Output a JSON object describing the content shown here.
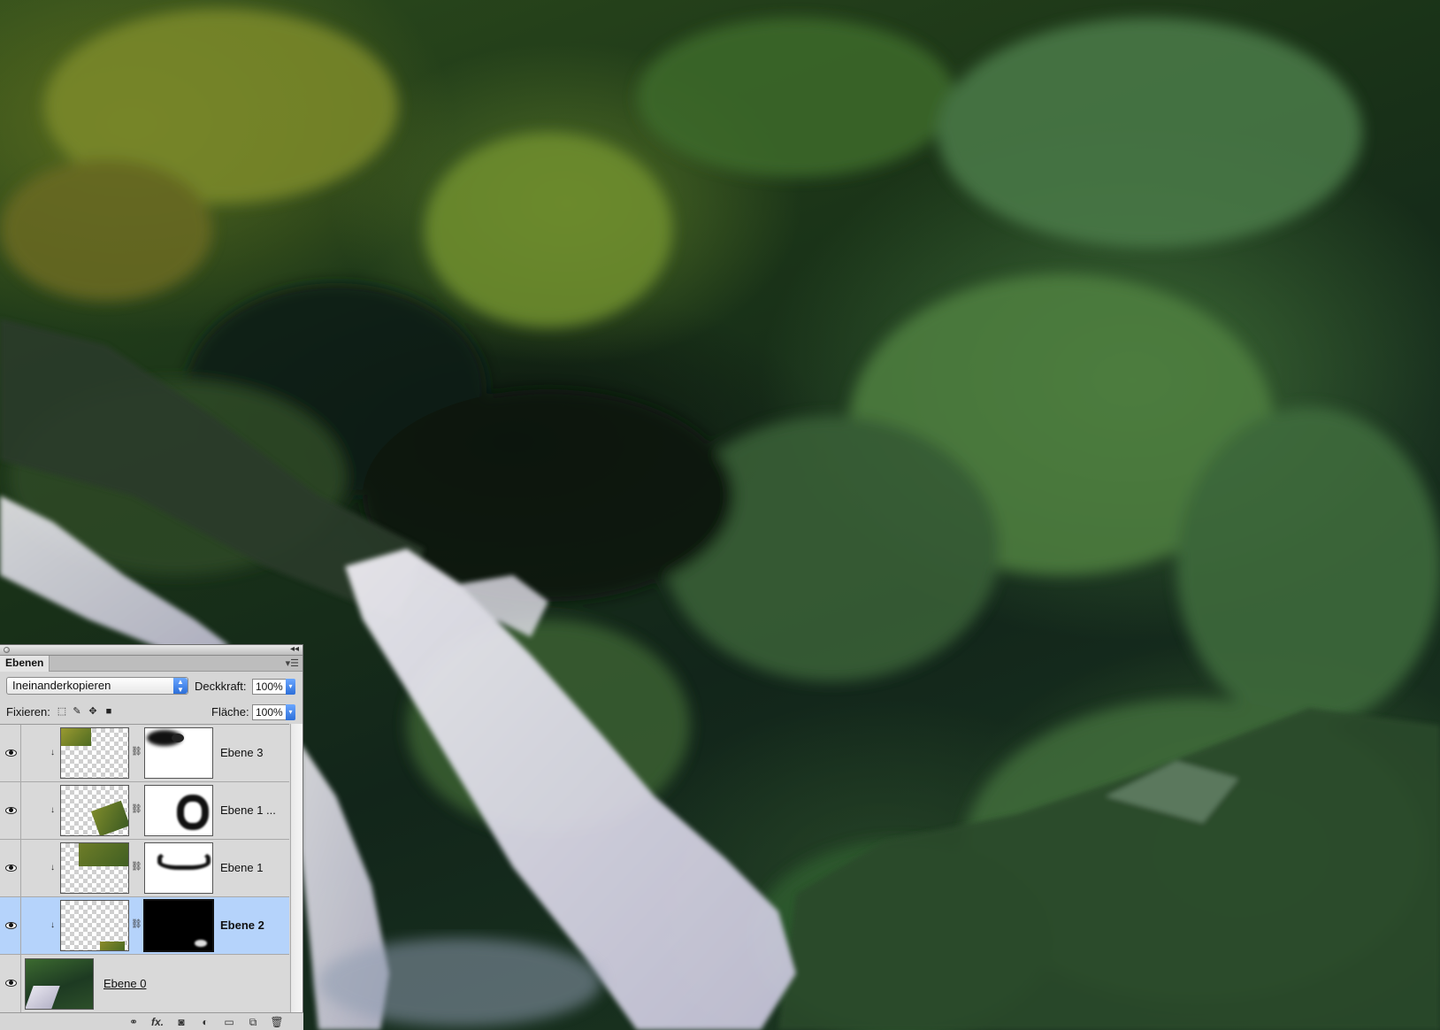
{
  "panel": {
    "tab_label": "Ebenen",
    "blend_mode": "Ineinanderkopieren",
    "opacity_label": "Deckkraft:",
    "opacity_value": "100%",
    "lock_label": "Fixieren:",
    "fill_label": "Fläche:",
    "fill_value": "100%",
    "lock_icons": [
      "transparent-pixels-lock-icon",
      "image-pixels-lock-icon",
      "position-lock-icon",
      "lock-all-icon"
    ],
    "bottom_icons": [
      "link-layers-icon",
      "fx-icon",
      "layer-mask-icon",
      "adjustment-layer-icon",
      "group-folder-icon",
      "new-layer-icon",
      "trash-icon"
    ],
    "fx_glyph": "fx."
  },
  "layers": [
    {
      "name": "Ebene 3",
      "visible": true,
      "clipped": true,
      "selected": false
    },
    {
      "name": "Ebene 1 ...",
      "visible": true,
      "clipped": true,
      "selected": false
    },
    {
      "name": "Ebene 1",
      "visible": true,
      "clipped": true,
      "selected": false
    },
    {
      "name": "Ebene 2",
      "visible": true,
      "clipped": true,
      "selected": true
    },
    {
      "name": "Ebene 0",
      "visible": true,
      "clipped": false,
      "selected": false
    }
  ],
  "colors": {
    "selection": "#b5d3fb",
    "panel_bg": "#d6d6d6",
    "accent_blue": "#2d6fd9"
  }
}
